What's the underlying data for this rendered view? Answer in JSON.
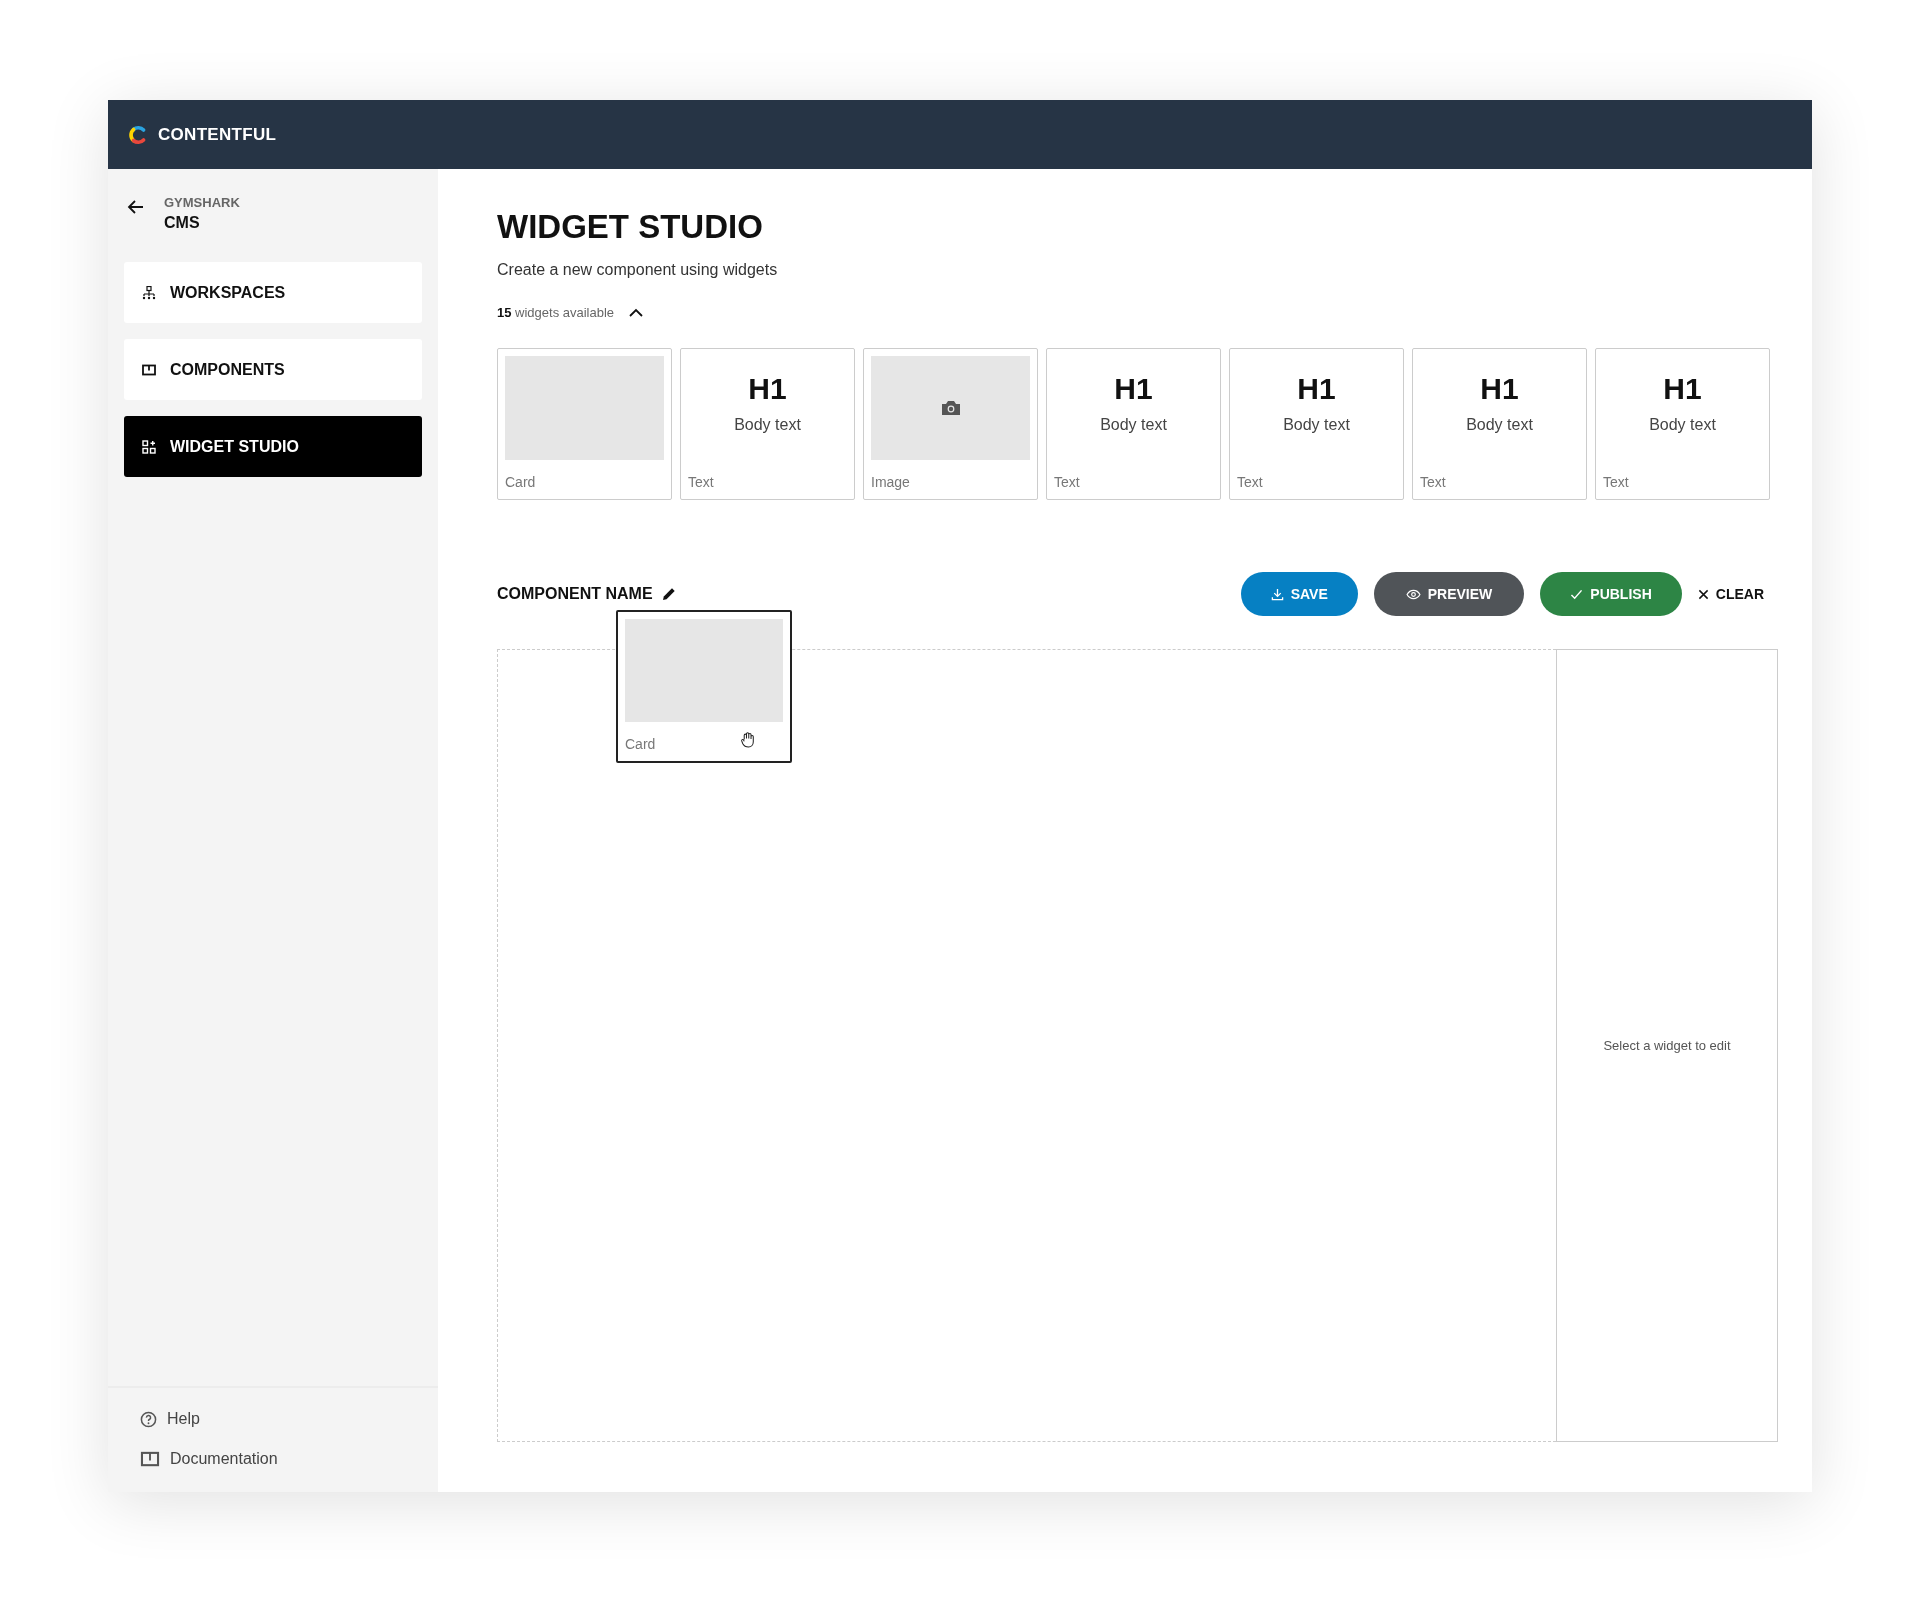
{
  "header": {
    "brand": "CONTENTFUL"
  },
  "sidebar": {
    "back": {
      "org": "GYMSHARK",
      "name": "CMS"
    },
    "nav": [
      {
        "label": "WORKSPACES",
        "kind": "workspaces",
        "selected": false
      },
      {
        "label": "COMPONENTS",
        "kind": "components",
        "selected": false
      },
      {
        "label": "WIDGET STUDIO",
        "kind": "studio",
        "selected": true
      }
    ],
    "footer": [
      {
        "label": "Help",
        "kind": "help"
      },
      {
        "label": "Documentation",
        "kind": "docs"
      }
    ]
  },
  "page": {
    "title": "WIDGET STUDIO",
    "subtitle": "Create a new component using widgets",
    "widget_count": {
      "count": "15",
      "label": "widgets available",
      "expanded": true
    }
  },
  "widgets": [
    {
      "kind": "card",
      "caption": "Card"
    },
    {
      "kind": "text",
      "heading": "H1",
      "body": "Body text",
      "caption": "Text"
    },
    {
      "kind": "image",
      "caption": "Image"
    },
    {
      "kind": "text",
      "heading": "H1",
      "body": "Body text",
      "caption": "Text"
    },
    {
      "kind": "text",
      "heading": "H1",
      "body": "Body text",
      "caption": "Text"
    },
    {
      "kind": "text",
      "heading": "H1",
      "body": "Body text",
      "caption": "Text"
    },
    {
      "kind": "text",
      "heading": "H1",
      "body": "Body text",
      "caption": "Text"
    }
  ],
  "editor": {
    "name_label": "COMPONENT NAME",
    "actions": [
      {
        "kind": "save",
        "label": "SAVE"
      },
      {
        "kind": "preview",
        "label": "PREVIEW"
      },
      {
        "kind": "publish",
        "label": "PUBLISH"
      },
      {
        "kind": "clear",
        "label": "CLEAR"
      }
    ],
    "dragged_widget": {
      "kind": "card",
      "caption": "Card"
    },
    "panel_hint": "Select a widget to edit"
  }
}
